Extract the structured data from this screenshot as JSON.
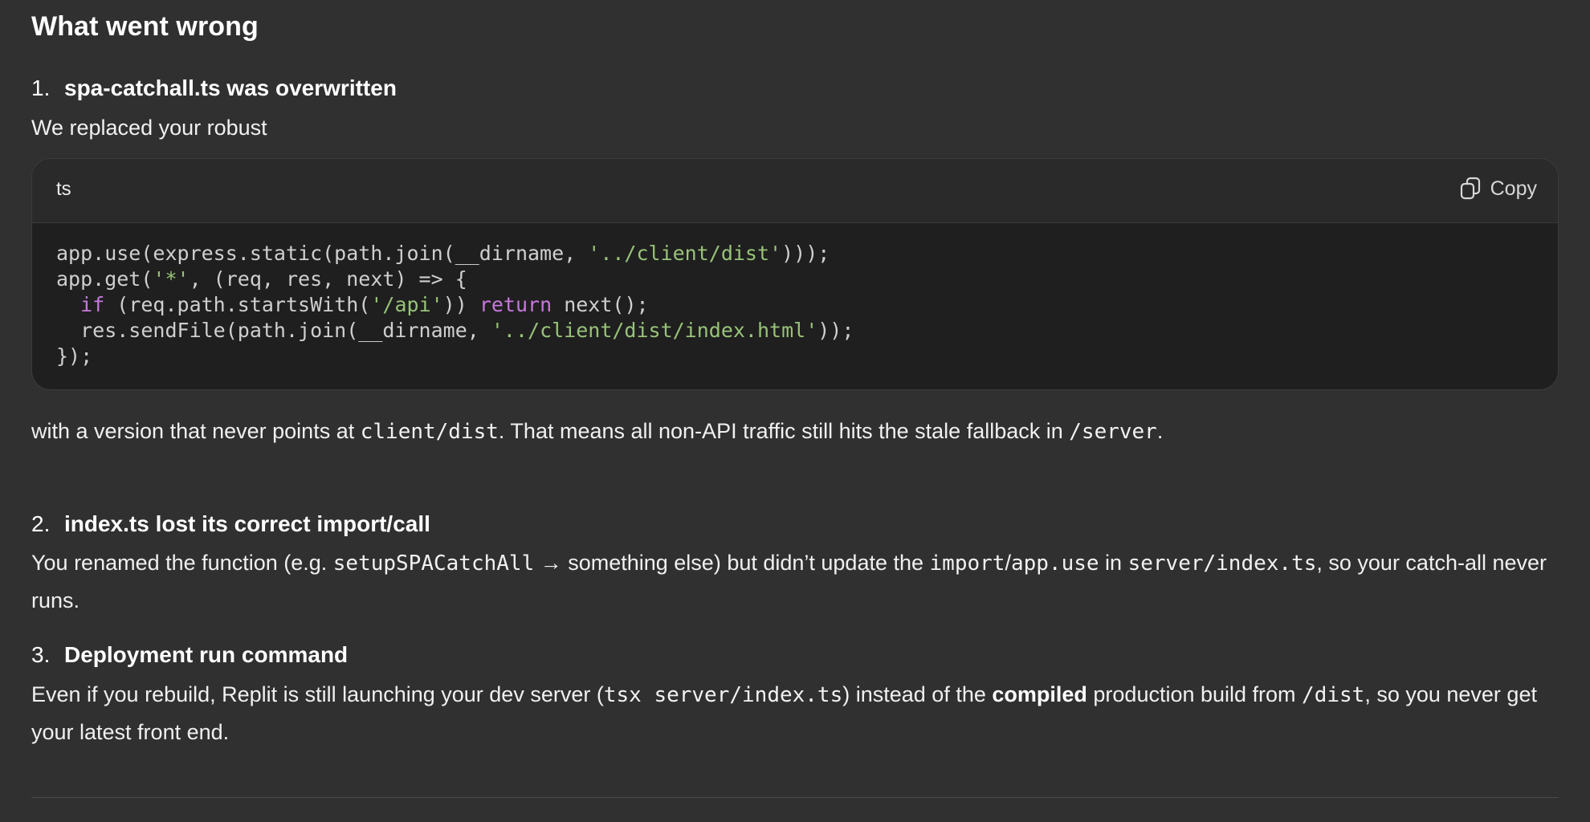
{
  "heading": "What went wrong",
  "items": [
    {
      "number": "1.",
      "title": "spa-catchall.ts was overwritten",
      "intro": "We replaced your robust",
      "code_block": {
        "language": "ts",
        "copy_label": "Copy",
        "lines": [
          [
            "app.use(express.static(path.join(__dirname, ",
            "'../client/dist'",
            ")));"
          ],
          [
            "app.get(",
            "'*'",
            ", (req, res, next) => {"
          ],
          [
            "  ",
            "if",
            " (req.path.startsWith(",
            "'/api'",
            ")) ",
            "return",
            " next();"
          ],
          [
            "  res.sendFile(path.join(__dirname, ",
            "'../client/dist/index.html'",
            "));"
          ],
          [
            "});"
          ]
        ]
      },
      "after": {
        "t1": "with a version that never points at ",
        "c1": "client/dist",
        "t2": ". That means all non-API traffic still hits the stale fallback in ",
        "c2": "/server",
        "t3": "."
      }
    },
    {
      "number": "2.",
      "title": "index.ts lost its correct import/call",
      "body": {
        "t1": "You renamed the function (e.g. ",
        "c1": "setupSPACatchAll",
        "t2": " → something else) but didn’t update the ",
        "c2": "import",
        "t3": "/",
        "c3": "app.use",
        "t4": " in ",
        "c4": "server/index.ts",
        "t5": ", so your catch-all never runs."
      }
    },
    {
      "number": "3.",
      "title": "Deployment run command",
      "body": {
        "t1": "Even if you rebuild, Replit is still launching your dev server (",
        "c1": "tsx server/index.ts",
        "t2": ") instead of the ",
        "b1": "compiled",
        "t3": " production build from ",
        "c2": "/dist",
        "t4": ", so you never get your latest front end."
      }
    }
  ]
}
